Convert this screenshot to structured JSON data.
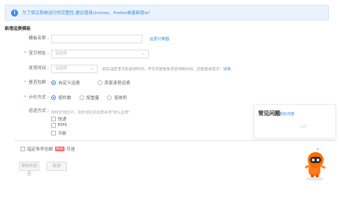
{
  "notice": {
    "text": "为了保证系统运行的完整性,建议使用chrome、firefox或者新版ie!"
  },
  "section_title": "新增运费模板",
  "form": {
    "template_name": {
      "label": "模板名称 :",
      "placeholder": "",
      "link": "运费计算器"
    },
    "ship_from": {
      "label": "宝贝地址 :",
      "placeholder": "请选择"
    },
    "ship_time": {
      "label": "发货时间 :",
      "placeholder": "请选择",
      "hint_pre": "如实设定宝贝的发货时间，不仅可避免发货咨询和纠纷，还能促进成交！",
      "hint_link": "详情"
    },
    "free_shipping": {
      "label": "是否包邮 :",
      "options": [
        "自定义运费",
        "卖家承担运费"
      ],
      "selected": 0
    },
    "pricing": {
      "label": "计价方式 :",
      "options": [
        "按件数",
        "按重量",
        "按体积"
      ],
      "selected": 0
    },
    "delivery": {
      "label": "运送方式 :",
      "note": "除指定地区外，其余地区的运费采用\"默认运费\"",
      "options": [
        "快递",
        "EMS",
        "平邮"
      ]
    }
  },
  "conditional_free": {
    "label_pre": "指定条件包邮",
    "badge": "New",
    "label_post": "可选"
  },
  "buttons": {
    "save": "保存并返回",
    "cancel": "取消"
  },
  "faq": {
    "title": "常见问题",
    "link": "其他问题"
  },
  "colors": {
    "accent": "#3a8ee6",
    "required": "#f56c6c",
    "notice_bg": "#eaf3fd"
  }
}
